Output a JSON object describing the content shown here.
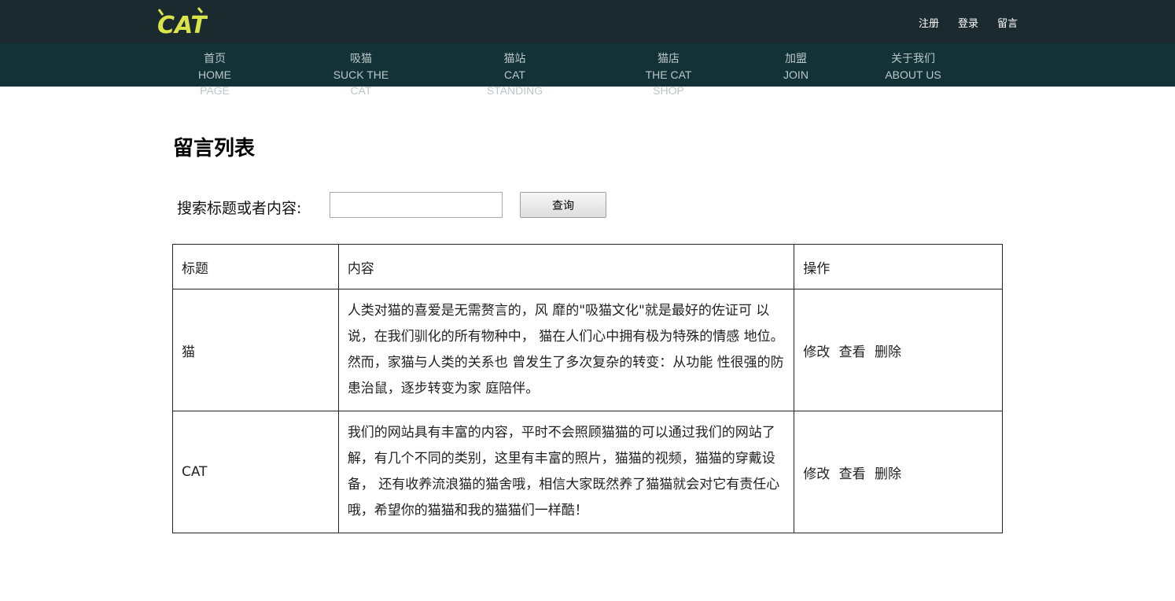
{
  "header": {
    "logo_text": "CAT",
    "user_links": [
      "注册",
      "登录",
      "留言"
    ]
  },
  "nav": [
    {
      "cn": "首页",
      "en": "HOME PAGE"
    },
    {
      "cn": "吸猫",
      "en": "SUCK THE CAT"
    },
    {
      "cn": "猫站",
      "en": "CAT STANDING"
    },
    {
      "cn": "猫店",
      "en": "THE CAT SHOP"
    },
    {
      "cn": "加盟",
      "en": "JOIN"
    },
    {
      "cn": "关于我们",
      "en": "ABOUT US"
    }
  ],
  "page": {
    "title": "留言列表"
  },
  "search": {
    "label": "搜索标题或者内容:",
    "value": "",
    "placeholder": "",
    "button": "查询"
  },
  "table": {
    "headers": [
      "标题",
      "内容",
      "操作"
    ],
    "rows": [
      {
        "title": "猫",
        "content": "人类对猫的喜爱是无需赘言的，风 靡的\"吸猫文化\"就是最好的佐证可 以说，在我们驯化的所有物种中， 猫在人们心中拥有极为特殊的情感 地位。然而，家猫与人类的关系也 曾发生了多次复杂的转变：从功能 性很强的防患治鼠，逐步转变为家 庭陪伴。",
        "ops": [
          "修改",
          "查看",
          "删除"
        ]
      },
      {
        "title": "CAT",
        "content": "我们的网站具有丰富的内容，平时不会照顾猫猫的可以通过我们的网站了解，有几个不同的类别，这里有丰富的照片，猫猫的视频，猫猫的穿戴设备， 还有收养流浪猫的猫舍哦，相信大家既然养了猫猫就会对它有责任心哦，希望你的猫猫和我的猫猫们一样酷！",
        "ops": [
          "修改",
          "查看",
          "删除"
        ]
      }
    ]
  },
  "colors": {
    "topbar": "#1a2a2e",
    "navbar": "#133238",
    "logo": "#d9e34a"
  }
}
